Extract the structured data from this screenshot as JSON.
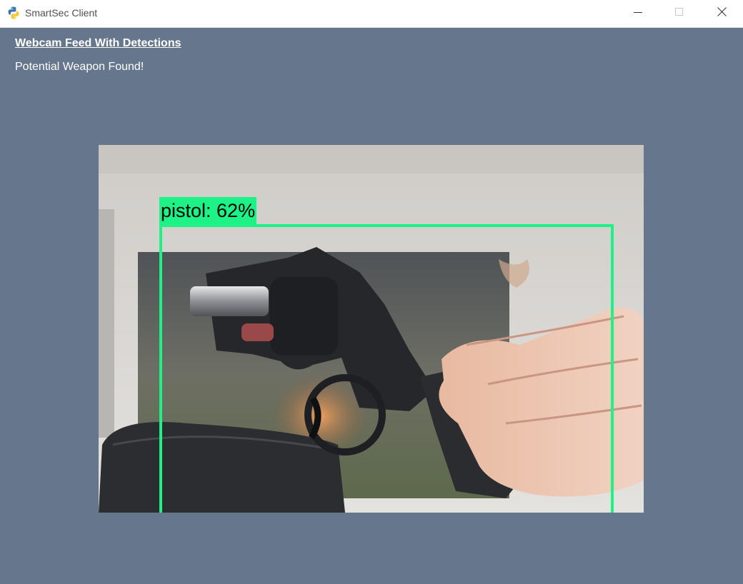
{
  "window": {
    "title": "SmartSec Client",
    "icon": "python-icon",
    "controls": [
      "minimize-icon",
      "maximize-icon",
      "close-icon"
    ]
  },
  "main": {
    "heading": "Webcam Feed With Detections",
    "status": "Potential Weapon Found!"
  },
  "feed": {
    "detection": {
      "label": "pistol: 62%",
      "color": "#1cf286"
    }
  },
  "colors": {
    "background": "#66768c",
    "titlebar": "#ffffff",
    "detection": "#1cf286"
  }
}
